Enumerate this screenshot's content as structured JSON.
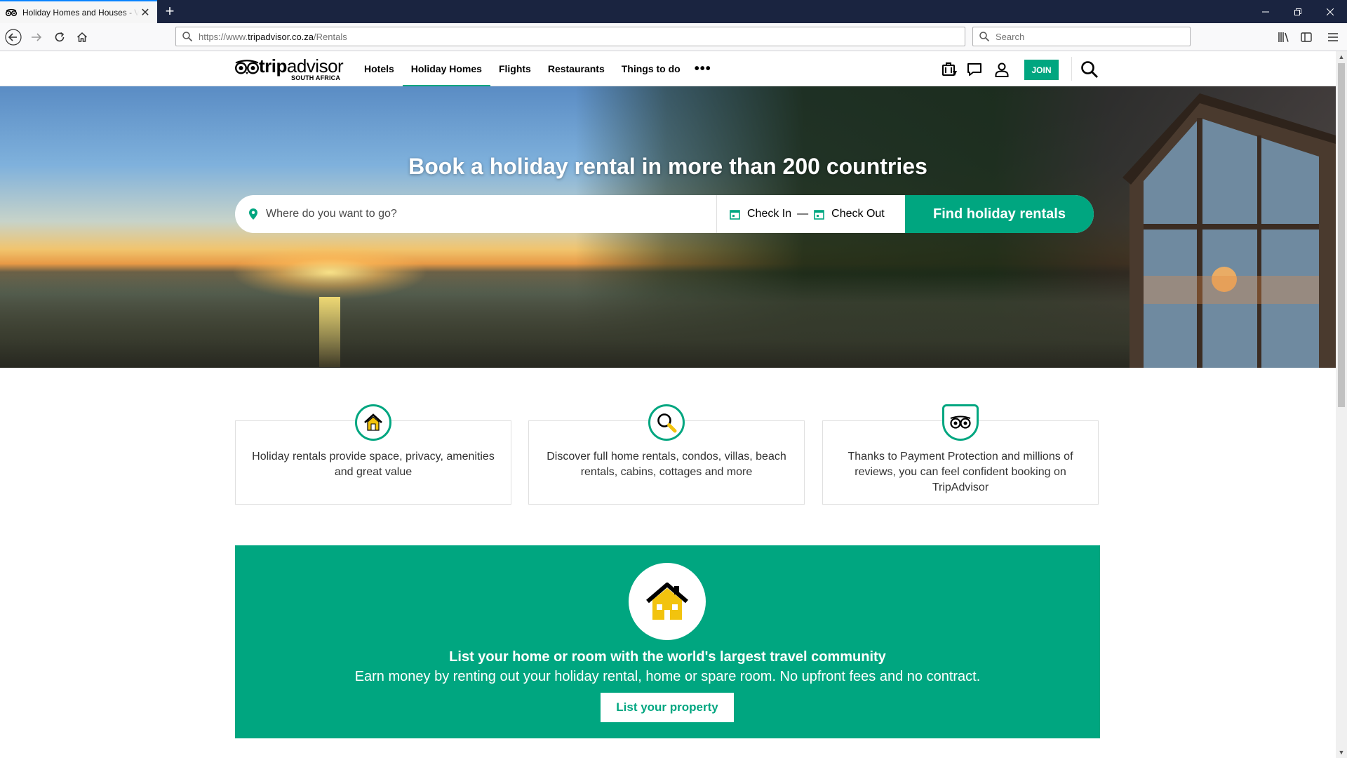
{
  "browser": {
    "tab_title": "Holiday Homes and Houses - V",
    "new_tab_label": "+",
    "url_scheme_host": "https://www.",
    "url_domain": "tripadvisor.co.za",
    "url_path": "/Rentals",
    "search_placeholder": "Search"
  },
  "header": {
    "logo_trip": "trip",
    "logo_advisor": "advisor",
    "logo_region": "SOUTH AFRICA",
    "nav": [
      "Hotels",
      "Holiday Homes",
      "Flights",
      "Restaurants",
      "Things to do"
    ],
    "active_nav": "Holiday Homes",
    "more_label": "•••",
    "join_label": "JOIN"
  },
  "hero": {
    "title": "Book a holiday rental in more than 200 countries",
    "where_placeholder": "Where do you want to go?",
    "check_in": "Check In",
    "date_separator": "—",
    "check_out": "Check Out",
    "find_button": "Find holiday rentals"
  },
  "features": [
    {
      "icon": "house-icon",
      "text": "Holiday rentals provide space, privacy, amenities and great value"
    },
    {
      "icon": "magnifier-icon",
      "text": "Discover full home rentals, condos, villas, beach rentals, cabins, cottages and more"
    },
    {
      "icon": "shield-owl-icon",
      "text": "Thanks to Payment Protection and millions of reviews, you can feel confident booking on TripAdvisor"
    }
  ],
  "promo": {
    "title": "List your home or room with the world's largest travel community",
    "subtitle": "Earn money by renting out your holiday rental, home or spare room. No upfront fees and no contract.",
    "button": "List your property"
  },
  "colors": {
    "brand_green": "#00a680",
    "titlebar": "#1a2440",
    "tab_accent": "#0a84ff"
  }
}
